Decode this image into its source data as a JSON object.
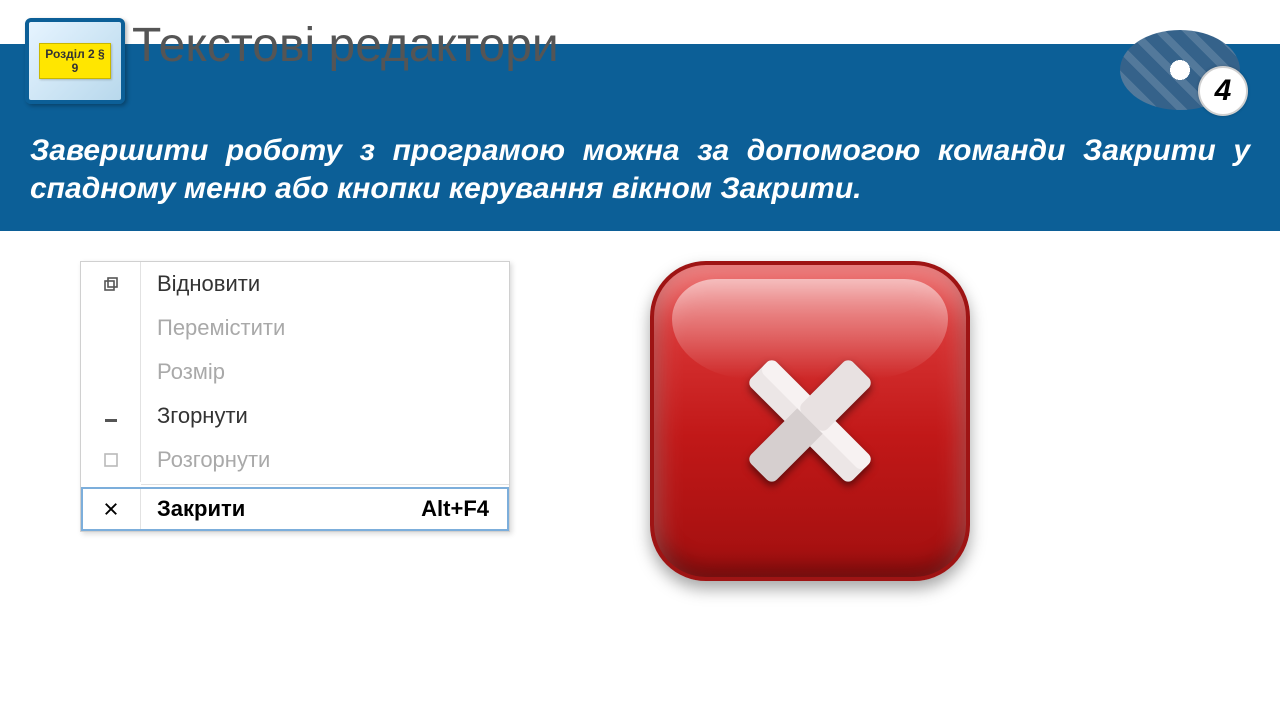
{
  "header": {
    "title": "Текстові редактори",
    "chapter": "Розділ 2 §\n9",
    "slide_number": "4"
  },
  "body_text": "Завершити роботу з програмою можна за допомогою команди Закрити у спадному меню або кнопки керування вікном Закрити.",
  "menu": {
    "items": [
      {
        "icon": "restore",
        "label": "Відновити",
        "enabled": true
      },
      {
        "icon": "",
        "label": "Перемістити",
        "enabled": false
      },
      {
        "icon": "",
        "label": "Розмір",
        "enabled": false
      },
      {
        "icon": "minimize",
        "label": "Згорнути",
        "enabled": true
      },
      {
        "icon": "maximize",
        "label": "Розгорнути",
        "enabled": false
      },
      {
        "icon": "close",
        "label": "Закрити",
        "enabled": true,
        "shortcut": "Alt+F4",
        "selected": true
      }
    ]
  }
}
